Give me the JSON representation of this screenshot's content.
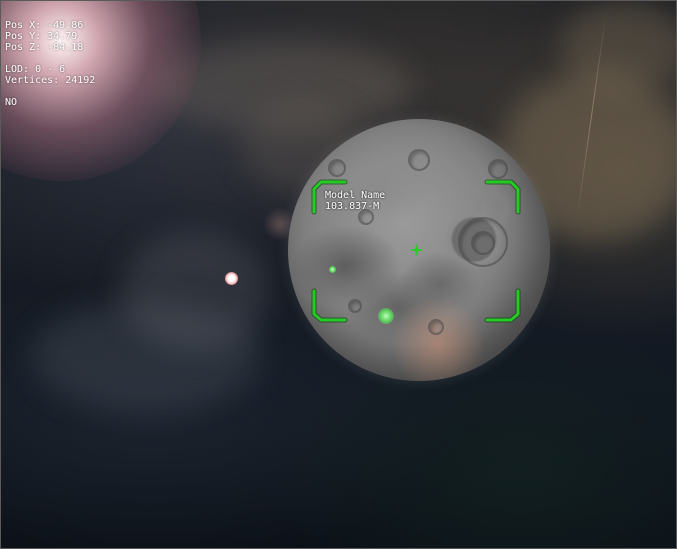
{
  "hud": {
    "pos_x": "Pos X: -49.86",
    "pos_y": "Pos Y: 34.79",
    "pos_z": "Pos Z: -84.18",
    "lod": "LOD: 0 - 6",
    "vertices": "Vertices: 24192",
    "flag": "NO"
  },
  "target": {
    "name": "Model Name",
    "distance": "103.837-M"
  },
  "colors": {
    "reticle": "#22cc22",
    "hud_text": "#ffffff",
    "sky": "#1b1d22"
  }
}
